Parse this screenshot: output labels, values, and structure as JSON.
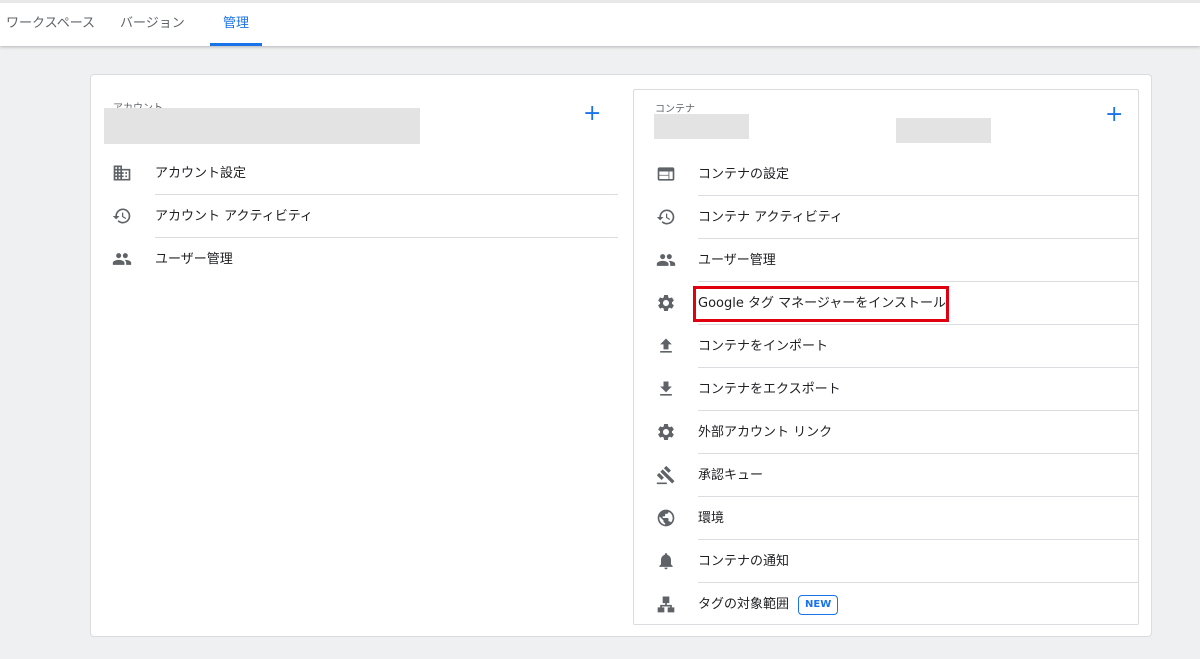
{
  "tabs": [
    {
      "label": "ワークスペース",
      "active": false
    },
    {
      "label": "バージョン",
      "active": false
    },
    {
      "label": "管理",
      "active": true
    }
  ],
  "account": {
    "section_label": "アカウント",
    "add_icon": "plus-icon",
    "items": [
      {
        "label": "アカウント設定",
        "icon": "building-icon"
      },
      {
        "label": "アカウント アクティビティ",
        "icon": "history-icon"
      },
      {
        "label": "ユーザー管理",
        "icon": "people-icon"
      }
    ]
  },
  "container": {
    "section_label": "コンテナ",
    "add_icon": "plus-icon",
    "items": [
      {
        "label": "コンテナの設定",
        "icon": "web-window-icon"
      },
      {
        "label": "コンテナ アクティビティ",
        "icon": "history-icon"
      },
      {
        "label": "ユーザー管理",
        "icon": "people-icon"
      },
      {
        "label": "Google タグ マネージャーをインストール",
        "icon": "gear-icon",
        "highlighted": true
      },
      {
        "label": "コンテナをインポート",
        "icon": "upload-icon"
      },
      {
        "label": "コンテナをエクスポート",
        "icon": "download-icon"
      },
      {
        "label": "外部アカウント リンク",
        "icon": "gear-icon"
      },
      {
        "label": "承認キュー",
        "icon": "gavel-icon"
      },
      {
        "label": "環境",
        "icon": "globe-icon"
      },
      {
        "label": "コンテナの通知",
        "icon": "bell-icon"
      },
      {
        "label": "タグの対象範囲",
        "icon": "hierarchy-icon",
        "badge": "NEW"
      }
    ]
  },
  "colors": {
    "accent": "#1a73e8",
    "highlight": "#e0000f",
    "icon": "#5f6368"
  }
}
